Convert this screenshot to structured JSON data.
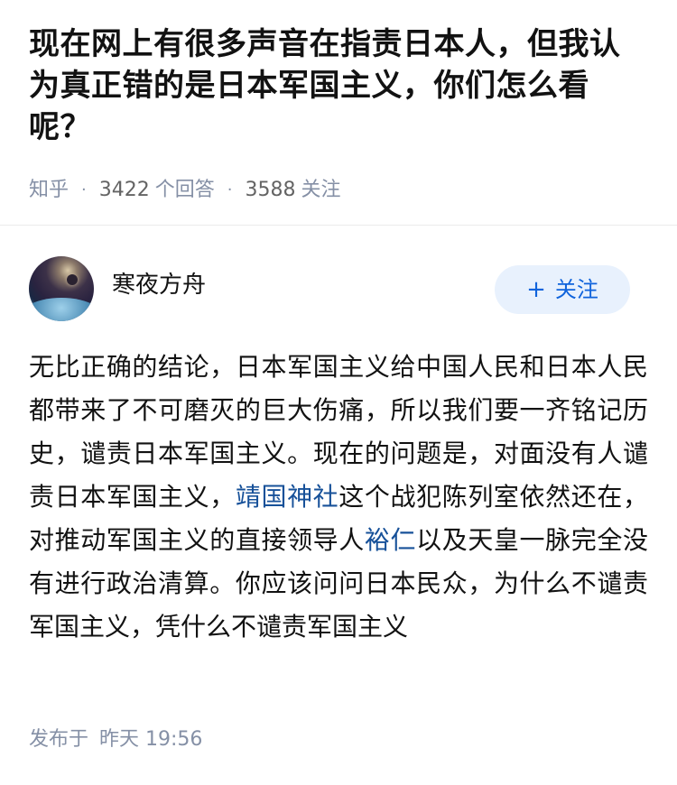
{
  "question": {
    "title": "现在网上有很多声音在指责日本人，但我认为真正错的是日本军国主义，你们怎么看呢？",
    "source": "知乎",
    "answer_count": "3422",
    "answer_label": "个回答",
    "follow_count": "3588",
    "follow_label": "关注",
    "separator": "·"
  },
  "author": {
    "name": "寒夜方舟",
    "follow_button_label": "关注",
    "follow_button_icon": "plus-icon"
  },
  "answer": {
    "text_1": "无比正确的结论，日本军国主义给中国人民和日本人民都带来了不可磨灭的巨大伤痛，所以我们要一齐铭记历史，谴责日本军国主义。现在的问题是，对面没有人谴责日本军国主义，",
    "link_1": "靖国神社",
    "text_2": "这个战犯陈列室依然还在，对推动军国主义的直接领导人",
    "link_2": "裕仁",
    "text_3": "以及天皇一脉完全没有进行政治清算。你应该问问日本民众，为什么不谴责军国主义，凭什么不谴责军国主义"
  },
  "publish": {
    "label": "发布于",
    "time": "昨天 19:56"
  },
  "colors": {
    "text": "#121212",
    "meta": "#8590a6",
    "link": "#175199",
    "follow_bg": "#e8f1fd",
    "follow_text": "#0f63dc"
  }
}
